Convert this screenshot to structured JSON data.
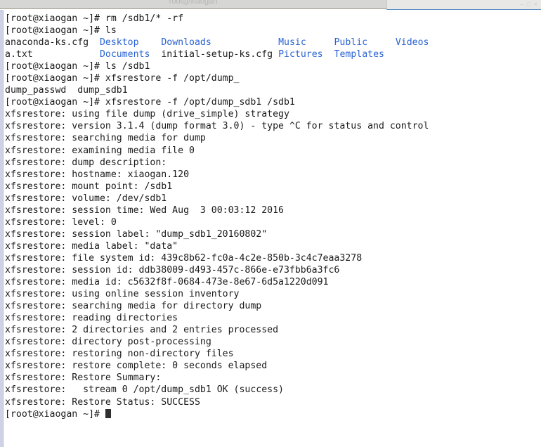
{
  "window": {
    "title": "root@xiaogan",
    "background_window_controls": "– □ ×"
  },
  "terminal": {
    "prompt": "[root@xiaogan ~]# ",
    "colors": {
      "background": "#ffffff",
      "foreground": "#1a1a1a",
      "directory_blue": "#2a63d2",
      "accent_blue": "#5b8fc9",
      "titlebar_gray": "#d6d6d4"
    },
    "cursor": "block",
    "lines": [
      {
        "segments": [
          {
            "text": "[root@xiaogan ~]# rm /sdb1/* -rf",
            "style": "plain"
          }
        ]
      },
      {
        "segments": [
          {
            "text": "[root@xiaogan ~]# ls",
            "style": "plain"
          }
        ]
      },
      {
        "segments": [
          {
            "text": "anaconda-ks.cfg  ",
            "style": "plain"
          },
          {
            "text": "Desktop",
            "style": "dir"
          },
          {
            "text": "    ",
            "style": "plain"
          },
          {
            "text": "Downloads",
            "style": "dir"
          },
          {
            "text": "            ",
            "style": "plain"
          },
          {
            "text": "Music",
            "style": "dir"
          },
          {
            "text": "     ",
            "style": "plain"
          },
          {
            "text": "Public",
            "style": "dir"
          },
          {
            "text": "     ",
            "style": "plain"
          },
          {
            "text": "Videos",
            "style": "dir"
          }
        ]
      },
      {
        "segments": [
          {
            "text": "a.txt            ",
            "style": "plain"
          },
          {
            "text": "Documents",
            "style": "dir"
          },
          {
            "text": "  initial-setup-ks.cfg ",
            "style": "plain"
          },
          {
            "text": "Pictures",
            "style": "dir"
          },
          {
            "text": "  ",
            "style": "plain"
          },
          {
            "text": "Templates",
            "style": "dir"
          }
        ]
      },
      {
        "segments": [
          {
            "text": "[root@xiaogan ~]# ls /sdb1",
            "style": "plain"
          }
        ]
      },
      {
        "segments": [
          {
            "text": "[root@xiaogan ~]# xfsrestore -f /opt/dump_",
            "style": "plain"
          }
        ]
      },
      {
        "segments": [
          {
            "text": "dump_passwd  dump_sdb1",
            "style": "plain"
          }
        ]
      },
      {
        "segments": [
          {
            "text": "[root@xiaogan ~]# xfsrestore -f /opt/dump_sdb1 /sdb1",
            "style": "plain"
          }
        ]
      },
      {
        "segments": [
          {
            "text": "xfsrestore: using file dump (drive_simple) strategy",
            "style": "plain"
          }
        ]
      },
      {
        "segments": [
          {
            "text": "xfsrestore: version 3.1.4 (dump format 3.0) - type ^C for status and control",
            "style": "plain"
          }
        ]
      },
      {
        "segments": [
          {
            "text": "xfsrestore: searching media for dump",
            "style": "plain"
          }
        ]
      },
      {
        "segments": [
          {
            "text": "xfsrestore: examining media file 0",
            "style": "plain"
          }
        ]
      },
      {
        "segments": [
          {
            "text": "xfsrestore: dump description:",
            "style": "plain"
          }
        ]
      },
      {
        "segments": [
          {
            "text": "xfsrestore: hostname: xiaogan.120",
            "style": "plain"
          }
        ]
      },
      {
        "segments": [
          {
            "text": "xfsrestore: mount point: /sdb1",
            "style": "plain"
          }
        ]
      },
      {
        "segments": [
          {
            "text": "xfsrestore: volume: /dev/sdb1",
            "style": "plain"
          }
        ]
      },
      {
        "segments": [
          {
            "text": "xfsrestore: session time: Wed Aug  3 00:03:12 2016",
            "style": "plain"
          }
        ]
      },
      {
        "segments": [
          {
            "text": "xfsrestore: level: 0",
            "style": "plain"
          }
        ]
      },
      {
        "segments": [
          {
            "text": "xfsrestore: session label: \"dump_sdb1_20160802\"",
            "style": "plain"
          }
        ]
      },
      {
        "segments": [
          {
            "text": "xfsrestore: media label: \"data\"",
            "style": "plain"
          }
        ]
      },
      {
        "segments": [
          {
            "text": "xfsrestore: file system id: 439c8b62-fc0a-4c2e-850b-3c4c7eaa3278",
            "style": "plain"
          }
        ]
      },
      {
        "segments": [
          {
            "text": "xfsrestore: session id: ddb38009-d493-457c-866e-e73fbb6a3fc6",
            "style": "plain"
          }
        ]
      },
      {
        "segments": [
          {
            "text": "xfsrestore: media id: c5632f8f-0684-473e-8e67-6d5a1220d091",
            "style": "plain"
          }
        ]
      },
      {
        "segments": [
          {
            "text": "xfsrestore: using online session inventory",
            "style": "plain"
          }
        ]
      },
      {
        "segments": [
          {
            "text": "xfsrestore: searching media for directory dump",
            "style": "plain"
          }
        ]
      },
      {
        "segments": [
          {
            "text": "xfsrestore: reading directories",
            "style": "plain"
          }
        ]
      },
      {
        "segments": [
          {
            "text": "xfsrestore: 2 directories and 2 entries processed",
            "style": "plain"
          }
        ]
      },
      {
        "segments": [
          {
            "text": "xfsrestore: directory post-processing",
            "style": "plain"
          }
        ]
      },
      {
        "segments": [
          {
            "text": "xfsrestore: restoring non-directory files",
            "style": "plain"
          }
        ]
      },
      {
        "segments": [
          {
            "text": "xfsrestore: restore complete: 0 seconds elapsed",
            "style": "plain"
          }
        ]
      },
      {
        "segments": [
          {
            "text": "xfsrestore: Restore Summary:",
            "style": "plain"
          }
        ]
      },
      {
        "segments": [
          {
            "text": "xfsrestore:   stream 0 /opt/dump_sdb1 OK (success)",
            "style": "plain"
          }
        ]
      },
      {
        "segments": [
          {
            "text": "xfsrestore: Restore Status: SUCCESS",
            "style": "plain"
          }
        ]
      },
      {
        "segments": [
          {
            "text": "[root@xiaogan ~]# ",
            "style": "plain"
          }
        ],
        "cursor": true
      }
    ]
  }
}
